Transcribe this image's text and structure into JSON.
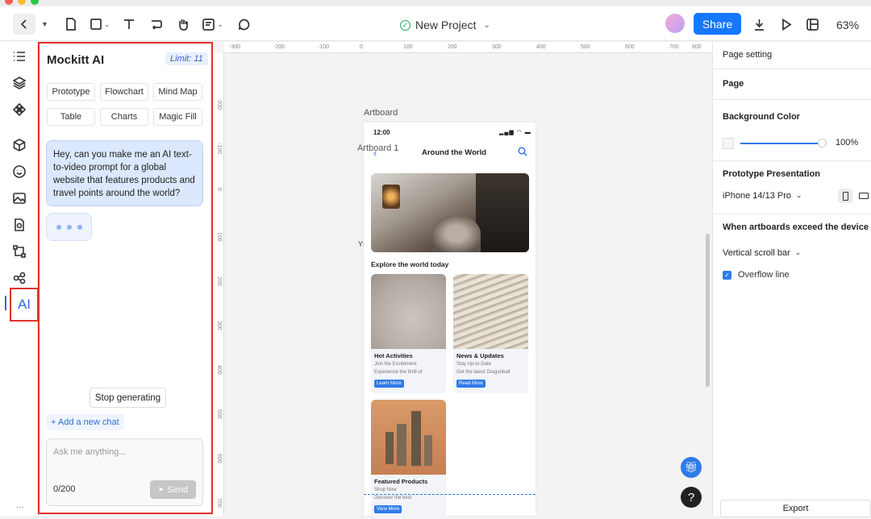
{
  "toolbar": {
    "project_name": "New Project",
    "share_label": "Share",
    "zoom": "63%"
  },
  "ai_panel": {
    "title": "Mockitt AI",
    "limit": "Limit: 11",
    "chips": [
      "Prototype",
      "Flowchart",
      "Mind Map",
      "Table",
      "Charts",
      "Magic Fill"
    ],
    "user_message": "Hey, can you make me an AI text-to-video prompt for a global website that features products and travel points around the world?",
    "stop_label": "Stop generating",
    "new_chat_label": "+ Add a new chat",
    "input_placeholder": "Ask me anything...",
    "char_count": "0/200",
    "send_label": "Send"
  },
  "leftbar": {
    "ai_label": "AI"
  },
  "canvas": {
    "artboard_label": "Artboard",
    "artboard1_label": "Artboard 1",
    "ruler_top": [
      "-300",
      "-200",
      "-100",
      "0",
      "100",
      "200",
      "300",
      "400",
      "500",
      "600",
      "700",
      "800"
    ],
    "ruler_left": [
      "-200",
      "-100",
      "0",
      "100",
      "200",
      "300",
      "400",
      "500",
      "600",
      "700",
      "800"
    ]
  },
  "phone": {
    "time": "12:00",
    "header_title": "Around the World",
    "section_title": "Explore the world today",
    "cards": [
      {
        "title": "Hot Activities",
        "sub1": "Join the Excitement",
        "sub2": "Experience the thrill of",
        "button": "Learn More"
      },
      {
        "title": "News & Updates",
        "sub1": "Stay Up-to-Date",
        "sub2": "Get the latest Dragonball",
        "button": "Read More"
      },
      {
        "title": "Featured Products",
        "sub1": "Shop Now",
        "sub2": "Discover the best",
        "button": "View More"
      }
    ]
  },
  "right_panel": {
    "page_setting": "Page setting",
    "page": "Page",
    "bg_color_label": "Background Color",
    "bg_opacity": "100%",
    "proto_label": "Prototype Presentation",
    "device": "iPhone 14/13 Pro",
    "exceed_label": "When artboards exceed the device",
    "scroll_option": "Vertical scroll bar",
    "overflow_label": "Overflow line",
    "export_label": "Export"
  },
  "colors": {
    "accent": "#1677ff",
    "highlight": "#e0322b",
    "ai_blue": "#2b6ae0"
  }
}
